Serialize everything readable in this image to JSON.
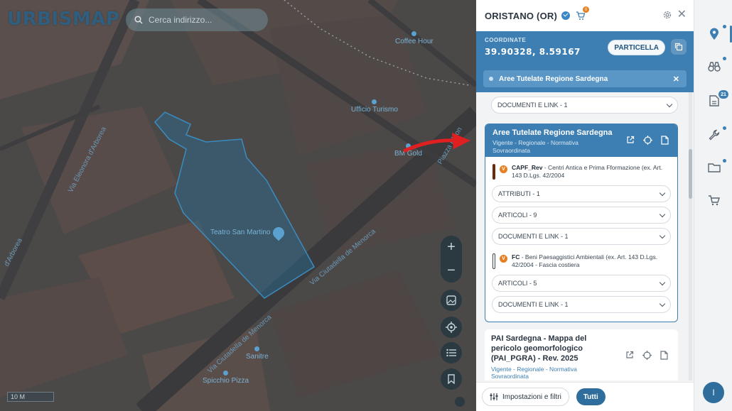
{
  "app": {
    "logo": "URBISMAP"
  },
  "search": {
    "placeholder": "Cerca indirizzo..."
  },
  "map": {
    "pois": [
      {
        "label": "Coffee Hour"
      },
      {
        "label": "Ufficio Turismo"
      },
      {
        "label": "BM Gold"
      },
      {
        "label": "Teatro San Martino"
      },
      {
        "label": "Sanitre"
      },
      {
        "label": "Spicchio Pizza"
      }
    ],
    "streets": [
      "Via Eleonora d'Arborea",
      "Via Ciutadella de Menorca",
      "Via Ciutadella de Menorca",
      "Via Ciutadella de Menorca",
      "d'Arborea",
      "Piazza Eleon"
    ],
    "scale": "10 M",
    "controls": {
      "zoom_in": "+",
      "zoom_out": "−"
    }
  },
  "panel": {
    "title": "ORISTANO (OR)",
    "cart_count": "0",
    "coord_label": "COORDINATE",
    "coord_value": "39.90328, 8.59167",
    "particella_label": "PARTICELLA",
    "filter_chip": "Aree Tutelate Regione Sardegna",
    "top_dropdown": "DOCUMENTI E LINK - 1",
    "card_main": {
      "title": "Aree Tutelate Regione Sardegna",
      "subtitle": "Vigente - Regionale - Normativa Sovraordinata",
      "layers": [
        {
          "badge": "V",
          "code": "CAPF_Rev",
          "desc": " - Centri Antica e Prima Fformazione (ex. Art. 143 D.Lgs. 42/2004",
          "color": "#6b2a0c",
          "dropdowns": [
            "ATTRIBUTI - 1",
            "ARTICOLI - 9",
            "DOCUMENTI E LINK - 1"
          ]
        },
        {
          "badge": "V",
          "code": "FC",
          "desc": " - Beni Paesaggistici Ambientali (ex. Art. 143 D.Lgs. 42/2004 - Fascia costiera",
          "color": "#ffffff",
          "dropdowns": [
            "ARTICOLI - 5",
            "DOCUMENTI E LINK - 1"
          ]
        }
      ]
    },
    "card_2": {
      "title": "PAI Sardegna - Mappa del pericolo geomorfologico (PAI_PGRA) - Rev. 2025",
      "subtitle": "Vigente - Regionale - Normativa Sovraordinata"
    },
    "footer": {
      "settings_label": "Impostazioni e filtri",
      "tutti_label": "Tutti"
    }
  },
  "rail": {
    "badge_count": "21",
    "avatar_initial": "I",
    "items": [
      "map-pin-icon",
      "binoculars-icon",
      "document-icon",
      "wrench-icon",
      "folder-icon",
      "cart-icon"
    ]
  },
  "colors": {
    "accent": "#3d7fb3",
    "orange": "#e67e22",
    "arrow": "#e02020"
  }
}
